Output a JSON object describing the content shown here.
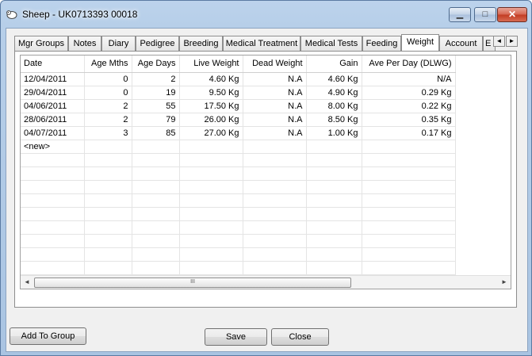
{
  "window": {
    "title": "Sheep - UK0713393 00018"
  },
  "controls": {
    "minimize": "▁",
    "maximize": "□",
    "close": "✕"
  },
  "tabs": [
    {
      "label": "Mgr Groups"
    },
    {
      "label": "Notes"
    },
    {
      "label": "Diary"
    },
    {
      "label": "Pedigree"
    },
    {
      "label": "Breeding"
    },
    {
      "label": "Medical Treatment"
    },
    {
      "label": "Medical Tests"
    },
    {
      "label": "Feeding"
    },
    {
      "label": "Weight",
      "active": true
    },
    {
      "label": "Account"
    },
    {
      "label": "E"
    }
  ],
  "tab_nav": {
    "prev": "◄",
    "next": "►"
  },
  "table": {
    "columns": [
      "Date",
      "Age Mths",
      "Age Days",
      "Live Weight",
      "Dead Weight",
      "Gain",
      "Ave Per Day (DLWG)"
    ],
    "rows": [
      [
        "12/04/2011",
        "0",
        "2",
        "4.60 Kg",
        "N.A",
        "4.60 Kg",
        "N/A"
      ],
      [
        "29/04/2011",
        "0",
        "19",
        "9.50 Kg",
        "N.A",
        "4.90 Kg",
        "0.29 Kg"
      ],
      [
        "04/06/2011",
        "2",
        "55",
        "17.50 Kg",
        "N.A",
        "8.00 Kg",
        "0.22 Kg"
      ],
      [
        "28/06/2011",
        "2",
        "79",
        "26.00 Kg",
        "N.A",
        "8.50 Kg",
        "0.35 Kg"
      ],
      [
        "04/07/2011",
        "3",
        "85",
        "27.00 Kg",
        "N.A",
        "1.00 Kg",
        "0.17 Kg"
      ]
    ],
    "new_row_label": "<new>"
  },
  "scrollbar": {
    "left": "◄",
    "right": "►",
    "grip": "III"
  },
  "buttons": {
    "add_to_group": "Add To Group",
    "save": "Save",
    "close": "Close"
  }
}
